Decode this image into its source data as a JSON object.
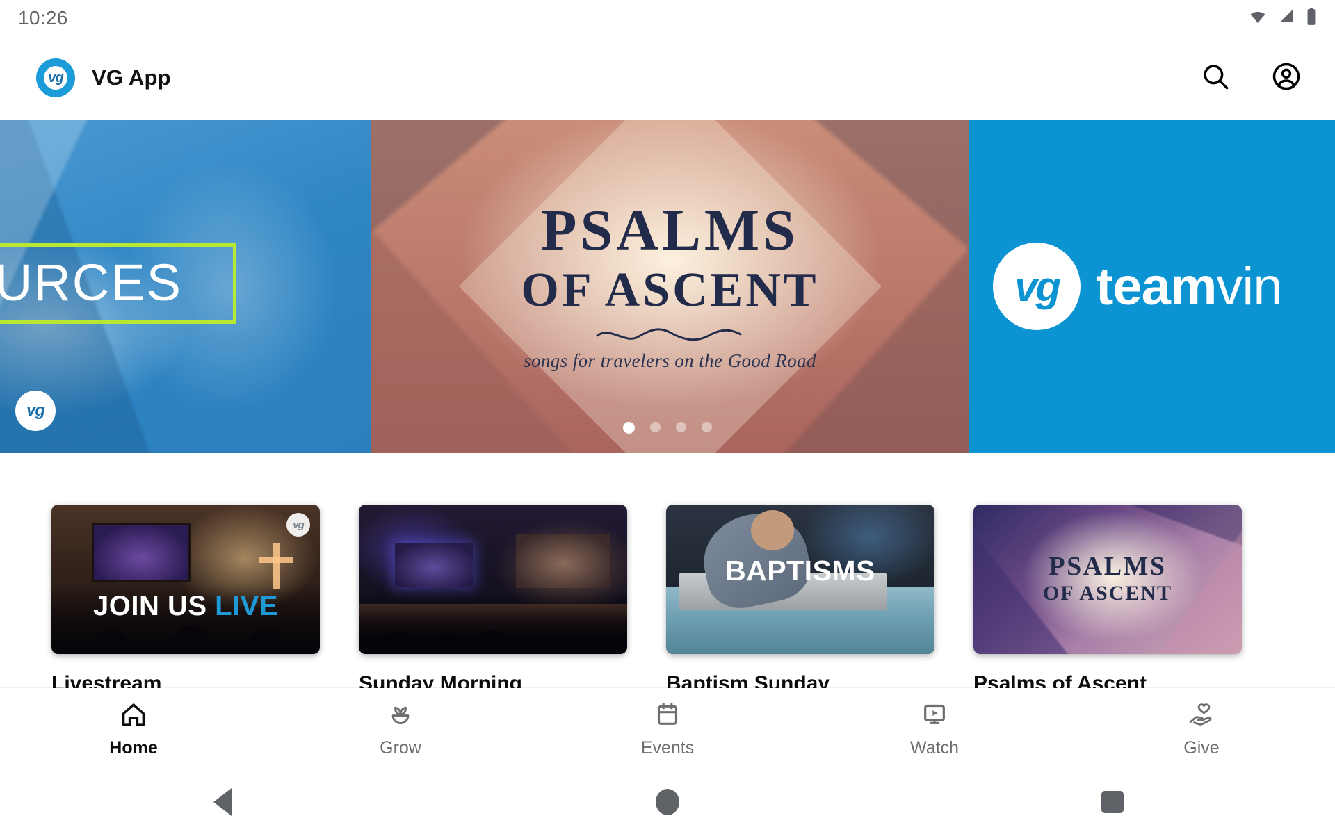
{
  "status_bar": {
    "time": "10:26",
    "icons": [
      "wifi-icon",
      "cell-signal-icon",
      "battery-icon"
    ]
  },
  "app_bar": {
    "logo_text": "vg",
    "title": "VG App",
    "actions": [
      {
        "name": "search-icon",
        "label": "Search"
      },
      {
        "name": "account-circle-icon",
        "label": "Account"
      }
    ]
  },
  "hero_carousel": {
    "slides": [
      {
        "id": "resources",
        "visible_text": "SOURCES",
        "full_title": "RESOURCES",
        "badge_text": "vg",
        "accent_color": "#b8e832",
        "background_color": "#2f86c4"
      },
      {
        "id": "psalms-of-ascent",
        "title_line1": "PSALMS",
        "title_line2": "OF ASCENT",
        "subtitle": "songs for travelers on the Good Road",
        "text_color": "#232b4a"
      },
      {
        "id": "teamvine",
        "logo_text": "vg",
        "word_bold": "team",
        "word_light": "vin",
        "background_color": "#0c93d2"
      }
    ],
    "dots": {
      "count": 4,
      "active_index": 0
    }
  },
  "cards": [
    {
      "title": "Livestream",
      "overlay_text_white": "JOIN US ",
      "overlay_text_accent": "LIVE",
      "badge_text": "vg",
      "accent_color": "#1f9ad6"
    },
    {
      "title": "Sunday Morning",
      "overlay_text": ""
    },
    {
      "title": "Baptism Sunday",
      "overlay_text": "BAPTISMS"
    },
    {
      "title": "Psalms of Ascent",
      "overlay_line1": "PSALMS",
      "overlay_line2": "OF ASCENT"
    }
  ],
  "bottom_nav": {
    "active_index": 0,
    "items": [
      {
        "label": "Home",
        "icon": "home-icon"
      },
      {
        "label": "Grow",
        "icon": "seedling-icon"
      },
      {
        "label": "Events",
        "icon": "calendar-icon"
      },
      {
        "label": "Watch",
        "icon": "video-monitor-icon"
      },
      {
        "label": "Give",
        "icon": "hand-heart-icon"
      }
    ]
  },
  "system_nav": {
    "buttons": [
      {
        "name": "back-button",
        "icon": "triangle-back-icon"
      },
      {
        "name": "home-button",
        "icon": "circle-home-icon"
      },
      {
        "name": "recents-button",
        "icon": "square-recents-icon"
      }
    ]
  }
}
